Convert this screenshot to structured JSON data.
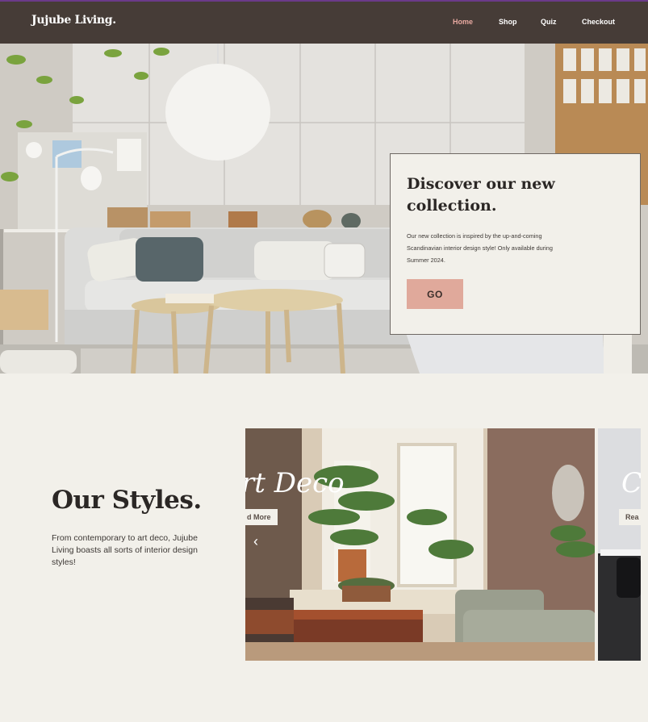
{
  "brand": {
    "logo": "Jujube Living."
  },
  "nav": {
    "items": [
      {
        "label": "Home",
        "active": true
      },
      {
        "label": "Shop",
        "active": false
      },
      {
        "label": "Quiz",
        "active": false
      },
      {
        "label": "Checkout",
        "active": false
      }
    ]
  },
  "hero": {
    "title": "Discover our new collection.",
    "description": "Our new collection is inspired by the up-and-coming Scandinavian interior design style! Only available during Summer 2024.",
    "button_label": "GO"
  },
  "styles": {
    "title": "Our Styles.",
    "description": "From contemporary to art deco, Jujube Living boasts all sorts of interior design styles!",
    "slides": [
      {
        "title": "rt Deco",
        "button_label": "d More"
      },
      {
        "title": "C",
        "button_label": "Rea"
      }
    ]
  },
  "colors": {
    "nav_bg": "#463c37",
    "nav_active": "#e8a9a0",
    "page_bg": "#f2f0ea",
    "button_bg": "#e0a99b",
    "text_dark": "#2b2725"
  }
}
